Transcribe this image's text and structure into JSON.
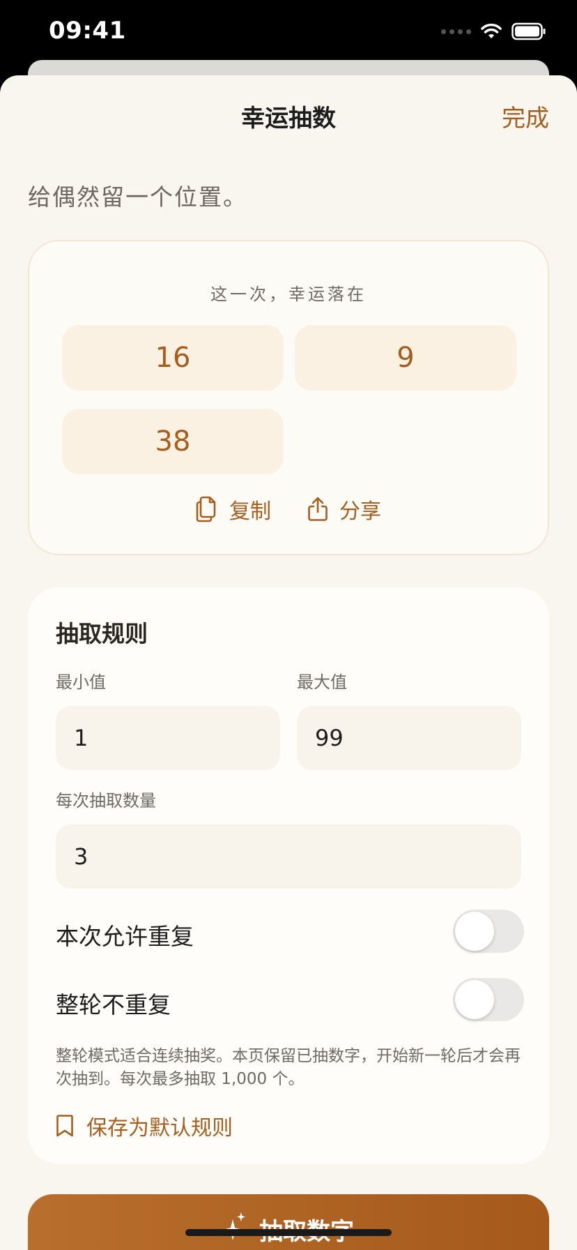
{
  "status_bar": {
    "time": "09:41"
  },
  "nav": {
    "title": "幸运抽数",
    "done_label": "完成"
  },
  "subtitle": "给偶然留一个位置。",
  "result": {
    "caption": "这一次，幸运落在",
    "numbers": [
      "16",
      "9",
      "38"
    ],
    "copy_label": "复制",
    "share_label": "分享"
  },
  "rules": {
    "title": "抽取规则",
    "min_label": "最小值",
    "min_value": "1",
    "max_label": "最大值",
    "max_value": "99",
    "count_label": "每次抽取数量",
    "count_value": "3",
    "allow_repeat_label": "本次允许重复",
    "allow_repeat_on": false,
    "no_repeat_round_label": "整轮不重复",
    "no_repeat_round_on": false,
    "note": "整轮模式适合连续抽奖。本页保留已抽数字，开始新一轮后才会再次抽到。每次最多抽取 1,000 个。",
    "save_default_label": "保存为默认规则"
  },
  "primary_button": {
    "label": "抽取数字"
  },
  "colors": {
    "accent": "#a55e1d",
    "background": "#f9f6f0",
    "chip": "#fbf1e3",
    "button": "#b0662a"
  },
  "icons": [
    "wifi-icon",
    "battery-icon",
    "copy-icon",
    "share-icon",
    "bookmark-icon",
    "sparkles-icon"
  ]
}
